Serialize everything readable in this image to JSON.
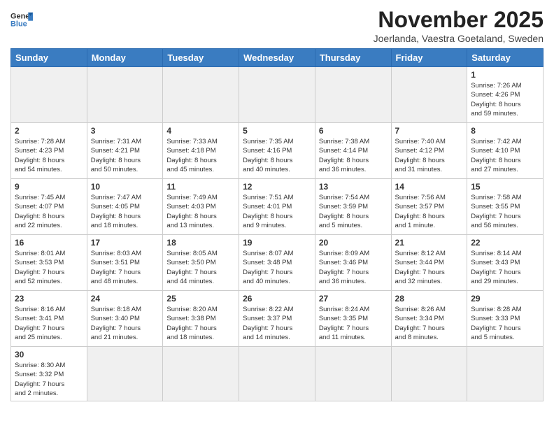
{
  "header": {
    "logo_general": "General",
    "logo_blue": "Blue",
    "title": "November 2025",
    "location": "Joerlanda, Vaestra Goetaland, Sweden"
  },
  "days_of_week": [
    "Sunday",
    "Monday",
    "Tuesday",
    "Wednesday",
    "Thursday",
    "Friday",
    "Saturday"
  ],
  "weeks": [
    [
      {
        "day": "",
        "info": ""
      },
      {
        "day": "",
        "info": ""
      },
      {
        "day": "",
        "info": ""
      },
      {
        "day": "",
        "info": ""
      },
      {
        "day": "",
        "info": ""
      },
      {
        "day": "",
        "info": ""
      },
      {
        "day": "1",
        "info": "Sunrise: 7:26 AM\nSunset: 4:26 PM\nDaylight: 8 hours\nand 59 minutes."
      }
    ],
    [
      {
        "day": "2",
        "info": "Sunrise: 7:28 AM\nSunset: 4:23 PM\nDaylight: 8 hours\nand 54 minutes."
      },
      {
        "day": "3",
        "info": "Sunrise: 7:31 AM\nSunset: 4:21 PM\nDaylight: 8 hours\nand 50 minutes."
      },
      {
        "day": "4",
        "info": "Sunrise: 7:33 AM\nSunset: 4:18 PM\nDaylight: 8 hours\nand 45 minutes."
      },
      {
        "day": "5",
        "info": "Sunrise: 7:35 AM\nSunset: 4:16 PM\nDaylight: 8 hours\nand 40 minutes."
      },
      {
        "day": "6",
        "info": "Sunrise: 7:38 AM\nSunset: 4:14 PM\nDaylight: 8 hours\nand 36 minutes."
      },
      {
        "day": "7",
        "info": "Sunrise: 7:40 AM\nSunset: 4:12 PM\nDaylight: 8 hours\nand 31 minutes."
      },
      {
        "day": "8",
        "info": "Sunrise: 7:42 AM\nSunset: 4:10 PM\nDaylight: 8 hours\nand 27 minutes."
      }
    ],
    [
      {
        "day": "9",
        "info": "Sunrise: 7:45 AM\nSunset: 4:07 PM\nDaylight: 8 hours\nand 22 minutes."
      },
      {
        "day": "10",
        "info": "Sunrise: 7:47 AM\nSunset: 4:05 PM\nDaylight: 8 hours\nand 18 minutes."
      },
      {
        "day": "11",
        "info": "Sunrise: 7:49 AM\nSunset: 4:03 PM\nDaylight: 8 hours\nand 13 minutes."
      },
      {
        "day": "12",
        "info": "Sunrise: 7:51 AM\nSunset: 4:01 PM\nDaylight: 8 hours\nand 9 minutes."
      },
      {
        "day": "13",
        "info": "Sunrise: 7:54 AM\nSunset: 3:59 PM\nDaylight: 8 hours\nand 5 minutes."
      },
      {
        "day": "14",
        "info": "Sunrise: 7:56 AM\nSunset: 3:57 PM\nDaylight: 8 hours\nand 1 minute."
      },
      {
        "day": "15",
        "info": "Sunrise: 7:58 AM\nSunset: 3:55 PM\nDaylight: 7 hours\nand 56 minutes."
      }
    ],
    [
      {
        "day": "16",
        "info": "Sunrise: 8:01 AM\nSunset: 3:53 PM\nDaylight: 7 hours\nand 52 minutes."
      },
      {
        "day": "17",
        "info": "Sunrise: 8:03 AM\nSunset: 3:51 PM\nDaylight: 7 hours\nand 48 minutes."
      },
      {
        "day": "18",
        "info": "Sunrise: 8:05 AM\nSunset: 3:50 PM\nDaylight: 7 hours\nand 44 minutes."
      },
      {
        "day": "19",
        "info": "Sunrise: 8:07 AM\nSunset: 3:48 PM\nDaylight: 7 hours\nand 40 minutes."
      },
      {
        "day": "20",
        "info": "Sunrise: 8:09 AM\nSunset: 3:46 PM\nDaylight: 7 hours\nand 36 minutes."
      },
      {
        "day": "21",
        "info": "Sunrise: 8:12 AM\nSunset: 3:44 PM\nDaylight: 7 hours\nand 32 minutes."
      },
      {
        "day": "22",
        "info": "Sunrise: 8:14 AM\nSunset: 3:43 PM\nDaylight: 7 hours\nand 29 minutes."
      }
    ],
    [
      {
        "day": "23",
        "info": "Sunrise: 8:16 AM\nSunset: 3:41 PM\nDaylight: 7 hours\nand 25 minutes."
      },
      {
        "day": "24",
        "info": "Sunrise: 8:18 AM\nSunset: 3:40 PM\nDaylight: 7 hours\nand 21 minutes."
      },
      {
        "day": "25",
        "info": "Sunrise: 8:20 AM\nSunset: 3:38 PM\nDaylight: 7 hours\nand 18 minutes."
      },
      {
        "day": "26",
        "info": "Sunrise: 8:22 AM\nSunset: 3:37 PM\nDaylight: 7 hours\nand 14 minutes."
      },
      {
        "day": "27",
        "info": "Sunrise: 8:24 AM\nSunset: 3:35 PM\nDaylight: 7 hours\nand 11 minutes."
      },
      {
        "day": "28",
        "info": "Sunrise: 8:26 AM\nSunset: 3:34 PM\nDaylight: 7 hours\nand 8 minutes."
      },
      {
        "day": "29",
        "info": "Sunrise: 8:28 AM\nSunset: 3:33 PM\nDaylight: 7 hours\nand 5 minutes."
      }
    ],
    [
      {
        "day": "30",
        "info": "Sunrise: 8:30 AM\nSunset: 3:32 PM\nDaylight: 7 hours\nand 2 minutes."
      },
      {
        "day": "",
        "info": ""
      },
      {
        "day": "",
        "info": ""
      },
      {
        "day": "",
        "info": ""
      },
      {
        "day": "",
        "info": ""
      },
      {
        "day": "",
        "info": ""
      },
      {
        "day": "",
        "info": ""
      }
    ]
  ]
}
